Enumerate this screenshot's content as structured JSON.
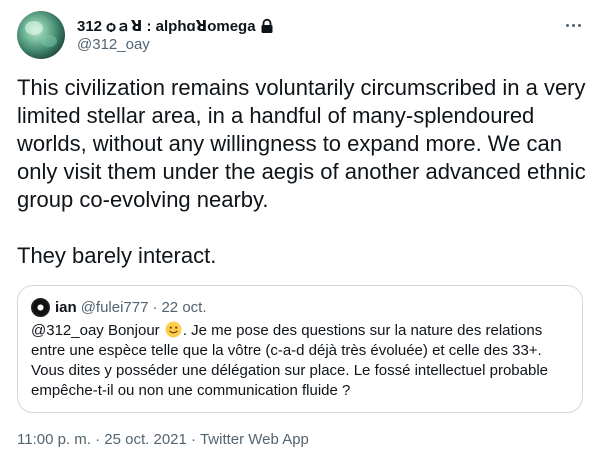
{
  "author": {
    "display_name": "312 ѻａꓤ : alphɑꓤomega",
    "handle": "@312_oay"
  },
  "tweet": {
    "text": "This civilization remains voluntarily circumscribed in a very limited stellar area, in a handful of many-splendoured worlds, without any willingness to expand more. We can only visit them under the aegis of another advanced ethnic group co-evolving nearby.\n\nThey barely interact."
  },
  "quote": {
    "display_name": "ian",
    "handle": "@fulei777",
    "separator": "·",
    "date": "22 oct.",
    "text_before": "@312_oay Bonjour",
    "text_after": ". Je me pose des questions sur la nature des relations entre une espèce telle que la vôtre (c-a-d déjà très évoluée) et celle des 33+. Vous dites y posséder une délégation sur place. Le fossé intellectuel probable empêche-t-il ou non une communication fluide ?"
  },
  "meta": {
    "time": "11:00 p. m.",
    "date": "25 oct. 2021",
    "source": "Twitter Web App",
    "separator": "·"
  },
  "icons": {
    "lock": "lock-icon",
    "more": "more-icon",
    "emoji": "slightly-smiling-face-emoji"
  }
}
